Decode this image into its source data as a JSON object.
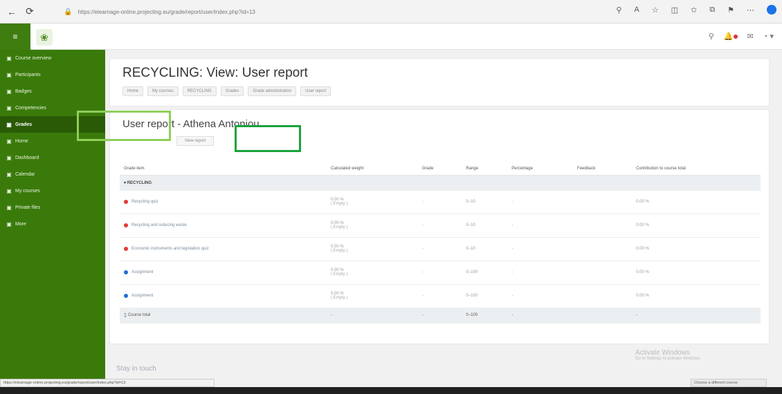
{
  "browser": {
    "url": "https://elearnage-online.projecting.eu/grade/report/user/index.php?id=13",
    "profile_color": "#1a73e8"
  },
  "topbar": {
    "hamburger_icon": "hamburger-icon",
    "logo_icon": "leaf-icon"
  },
  "sidebar": {
    "items": [
      {
        "icon": "dashboard-icon",
        "label": "Course overview"
      },
      {
        "icon": "participants-icon",
        "label": "Participants"
      },
      {
        "icon": "badges-icon",
        "label": "Badges"
      },
      {
        "icon": "competencies-icon",
        "label": "Competencies"
      },
      {
        "icon": "grades-icon",
        "label": "Grades"
      },
      {
        "icon": "home-icon",
        "label": "Home"
      },
      {
        "icon": "dashboard-icon",
        "label": "Dashboard"
      },
      {
        "icon": "calendar-icon",
        "label": "Calendar"
      },
      {
        "icon": "files-icon",
        "label": "My courses"
      },
      {
        "icon": "private-files-icon",
        "label": "Private files"
      },
      {
        "icon": "more-icon",
        "label": "More"
      }
    ],
    "active_index": 4
  },
  "header": {
    "title": "RECYCLING: View: User report",
    "breadcrumb": [
      "Home",
      "My courses",
      "RECYCLING",
      "Grades",
      "Grade administration",
      "User report"
    ]
  },
  "report": {
    "title": "User report - Athena Antoniou",
    "view_select": "View report",
    "columns": [
      "Grade item",
      "Calculated weight",
      "Grade",
      "Range",
      "Percentage",
      "Feedback",
      "Contribution to course total"
    ],
    "category": "RECYCLING",
    "rows": [
      {
        "name": "Recycling quiz",
        "icon_color": "#e53935",
        "weight": "0.00 %",
        "weight_sub": "( Empty )",
        "grade": "-",
        "range": "0–10",
        "percentage": "-",
        "feedback": "",
        "contribution": "0.00 %"
      },
      {
        "name": "Recycling and reducing waste",
        "icon_color": "#e53935",
        "weight": "0.00 %",
        "weight_sub": "( Empty )",
        "grade": "-",
        "range": "0–10",
        "percentage": "-",
        "feedback": "",
        "contribution": "0.00 %"
      },
      {
        "name": "Economic instruments and legislation quiz",
        "icon_color": "#e53935",
        "weight": "0.00 %",
        "weight_sub": "( Empty )",
        "grade": "-",
        "range": "0–10",
        "percentage": "-",
        "feedback": "",
        "contribution": "0.00 %"
      },
      {
        "name": "Assignment",
        "icon_color": "#1e6fd1",
        "weight": "0.00 %",
        "weight_sub": "( Empty )",
        "grade": "-",
        "range": "0–100",
        "percentage": "-",
        "feedback": "",
        "contribution": "0.00 %"
      },
      {
        "name": "Assignment",
        "icon_color": "#1e6fd1",
        "weight": "0.00 %",
        "weight_sub": "( Empty )",
        "grade": "-",
        "range": "0–100",
        "percentage": "-",
        "feedback": "",
        "contribution": "0.00 %"
      }
    ],
    "total": {
      "name": "Course total",
      "weight": "-",
      "grade": "-",
      "range": "0–100",
      "percentage": "-",
      "feedback": "",
      "contribution": "-"
    }
  },
  "footer": {
    "text": "Stay in touch",
    "activate_title": "Activate Windows",
    "activate_sub": "Go to Settings to activate Windows.",
    "status_url": "https://elearnage-online.projecting.eu/grade/report/user/index.php?id=13",
    "status_right": "Choose a different course"
  },
  "annotations": {
    "light_color": "#8fcf5a",
    "dark_color": "#18a33b"
  }
}
